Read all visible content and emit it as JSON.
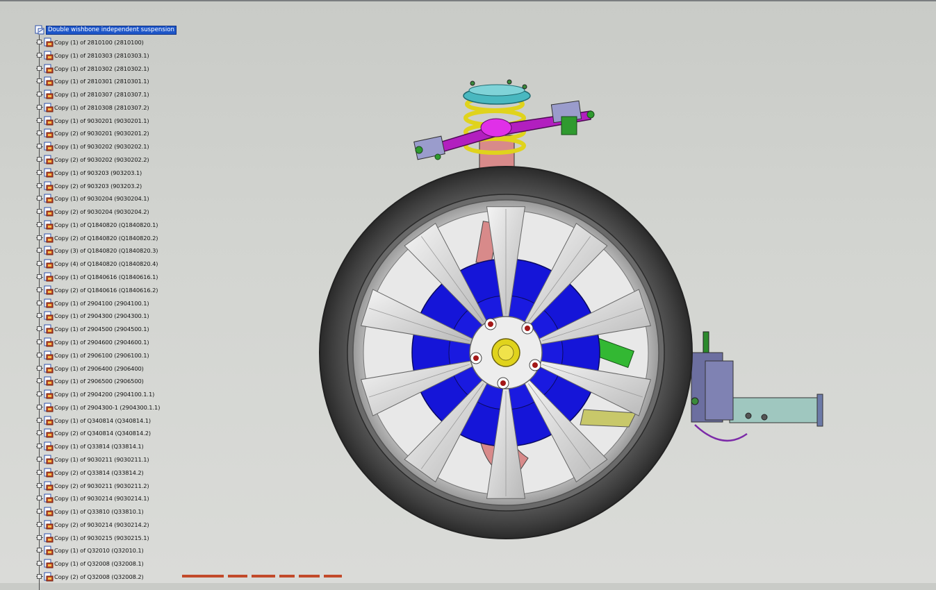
{
  "tree": {
    "root_label": "Double wishbone independent suspension",
    "items": [
      "Copy (1) of 2810100 (2810100)",
      "Copy (1) of 2810303 (2810303.1)",
      "Copy (1) of 2810302 (2810302.1)",
      "Copy (1) of 2810301 (2810301.1)",
      "Copy (1) of 2810307 (2810307.1)",
      "Copy (1) of 2810308 (2810307.2)",
      "Copy (1) of 9030201 (9030201.1)",
      "Copy (2) of 9030201 (9030201.2)",
      "Copy (1) of 9030202 (9030202.1)",
      "Copy (2) of 9030202 (9030202.2)",
      "Copy (1) of 903203 (903203.1)",
      "Copy (2) of 903203 (903203.2)",
      "Copy (1) of 9030204 (9030204.1)",
      "Copy (2) of 9030204 (9030204.2)",
      "Copy (1) of Q1840820 (Q1840820.1)",
      "Copy (2) of Q1840820 (Q1840820.2)",
      "Copy (3) of Q1840820 (Q1840820.3)",
      "Copy (4) of Q1840820 (Q1840820.4)",
      "Copy (1) of Q1840616 (Q1840616.1)",
      "Copy (2) of Q1840616 (Q1840616.2)",
      "Copy (1) of 2904100 (2904100.1)",
      "Copy (1) of 2904300 (2904300.1)",
      "Copy (1) of 2904500 (2904500.1)",
      "Copy (1) of 2904600 (2904600.1)",
      "Copy (1) of 2906100 (2906100.1)",
      "Copy (1) of 2906400 (2906400)",
      "Copy (1) of 2906500 (2906500)",
      "Copy (1) of 2904200 (2904100.1.1)",
      "Copy (1) of 2904300-1 (2904300.1.1)",
      "Copy (1) of Q340814 (Q340814.1)",
      "Copy (2) of Q340814 (Q340814.2)",
      "Copy (1) of Q33814 (Q33814.1)",
      "Copy (1) of 9030211 (9030211.1)",
      "Copy (2) of Q33814 (Q33814.2)",
      "Copy (2) of 9030211 (9030211.2)",
      "Copy (1) of 9030214 (9030214.1)",
      "Copy (1) of Q33810 (Q33810.1)",
      "Copy (2) of 9030214 (9030214.2)",
      "Copy (1) of 9030215 (9030215.1)",
      "Copy (1) of Q32010 (Q32010.1)",
      "Copy (1) of Q32008 (Q32008.1)",
      "Copy (2) of Q32008 (Q32008.2)"
    ]
  },
  "icons": {
    "root": "assembly-icon",
    "item": "product-part-icon",
    "expand": "expand-plus-icon"
  },
  "colors": {
    "selection": "#1e56c8",
    "rotor": "#1a1ad6",
    "tire": "#4a4a4a",
    "spring": "#e6d320",
    "wishbone": "#c020c0"
  }
}
